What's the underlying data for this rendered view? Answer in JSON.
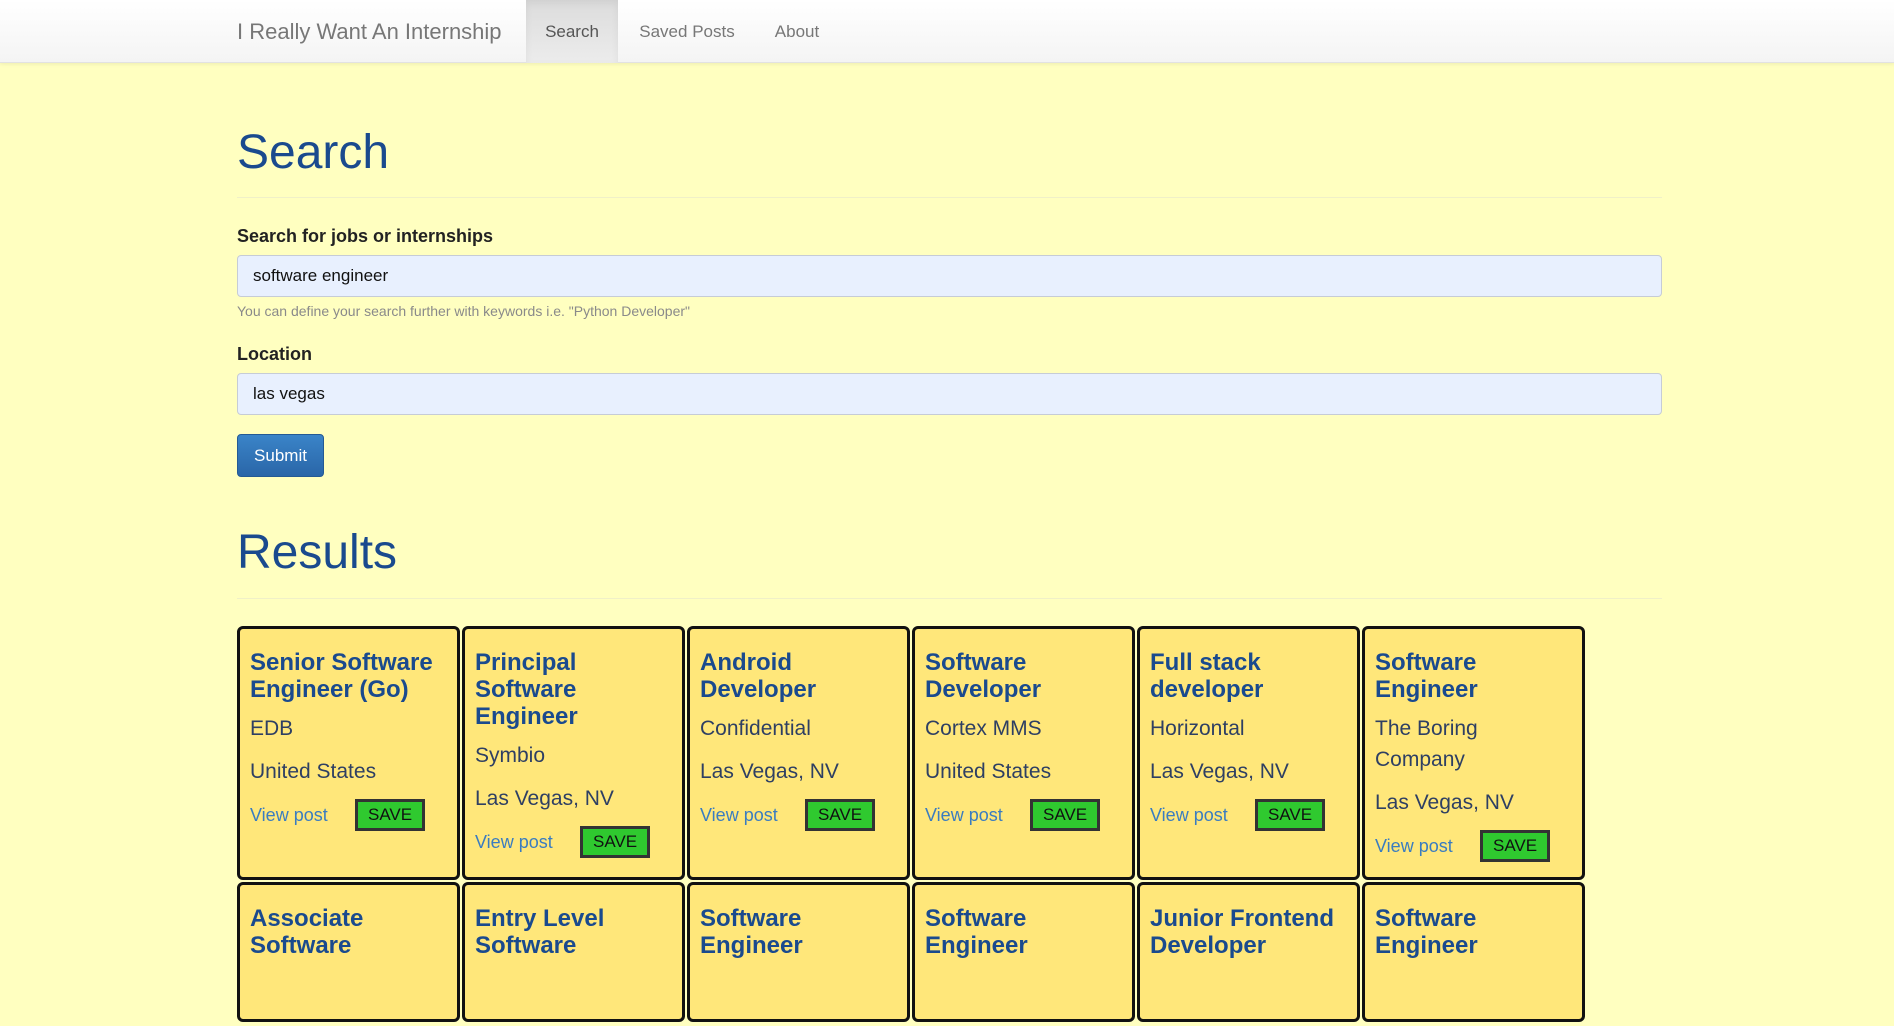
{
  "navbar": {
    "brand": "I Really Want An Internship",
    "items": [
      {
        "label": "Search",
        "active": true
      },
      {
        "label": "Saved Posts",
        "active": false
      },
      {
        "label": "About",
        "active": false
      }
    ]
  },
  "search": {
    "heading": "Search",
    "query_label": "Search for jobs or internships",
    "query_value": "software engineer",
    "query_help": "You can define your search further with keywords i.e. \"Python Developer\"",
    "location_label": "Location",
    "location_value": "las vegas",
    "submit_label": "Submit"
  },
  "results": {
    "heading": "Results",
    "view_label": "View post",
    "save_label": "SAVE",
    "cards": [
      {
        "title": "Senior Software Engineer (Go)",
        "company": "EDB",
        "location": "United States"
      },
      {
        "title": "Principal Software Engineer",
        "company": "Symbio",
        "location": "Las Vegas, NV"
      },
      {
        "title": "Android Developer",
        "company": "Confidential",
        "location": "Las Vegas, NV"
      },
      {
        "title": "Software Developer",
        "company": "Cortex MMS",
        "location": "United States"
      },
      {
        "title": "Full stack developer",
        "company": "Horizontal",
        "location": "Las Vegas, NV"
      },
      {
        "title": "Software Engineer",
        "company": "The Boring Company",
        "location": "Las Vegas, NV"
      },
      {
        "title": "Associate Software",
        "company": "",
        "location": ""
      },
      {
        "title": "Entry Level Software",
        "company": "",
        "location": ""
      },
      {
        "title": "Software Engineer",
        "company": "",
        "location": ""
      },
      {
        "title": "Software Engineer",
        "company": "",
        "location": ""
      },
      {
        "title": "Junior Frontend Developer",
        "company": "",
        "location": ""
      },
      {
        "title": "Software Engineer",
        "company": "",
        "location": ""
      }
    ]
  }
}
